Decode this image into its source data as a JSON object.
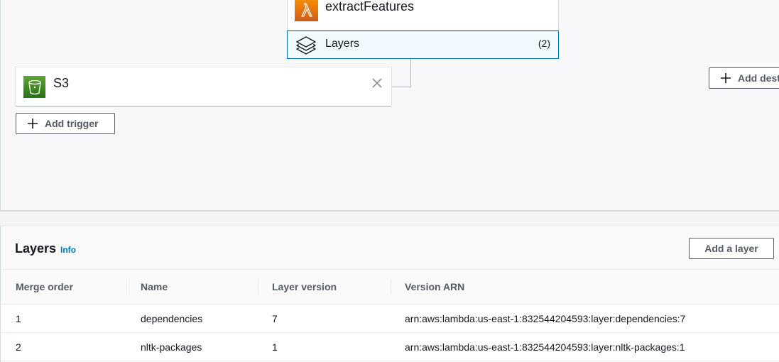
{
  "diagram": {
    "function_name": "extractFeatures",
    "layers_label": "Layers",
    "layers_count": "(2)",
    "trigger_name": "S3",
    "add_trigger_label": "Add trigger",
    "add_destination_label": "Add dest"
  },
  "layers_section": {
    "title": "Layers",
    "info_link": "Info",
    "add_layer_label": "Add a layer",
    "columns": [
      "Merge order",
      "Name",
      "Layer version",
      "Version ARN"
    ],
    "rows": [
      {
        "merge_order": "1",
        "name": "dependencies",
        "version": "7",
        "arn": "arn:aws:lambda:us-east-1:832544204593:layer:dependencies:7"
      },
      {
        "merge_order": "2",
        "name": "nltk-packages",
        "version": "1",
        "arn": "arn:aws:lambda:us-east-1:832544204593:layer:nltk-packages:1"
      }
    ]
  },
  "colors": {
    "lambda_orange": "#f78e04",
    "s3_green": "#3f8624",
    "link_blue": "#0073bb",
    "selected_border": "#0073bb"
  },
  "icons": [
    "lambda-icon",
    "layers-icon",
    "s3-bucket-icon",
    "close-icon",
    "plus-icon"
  ]
}
